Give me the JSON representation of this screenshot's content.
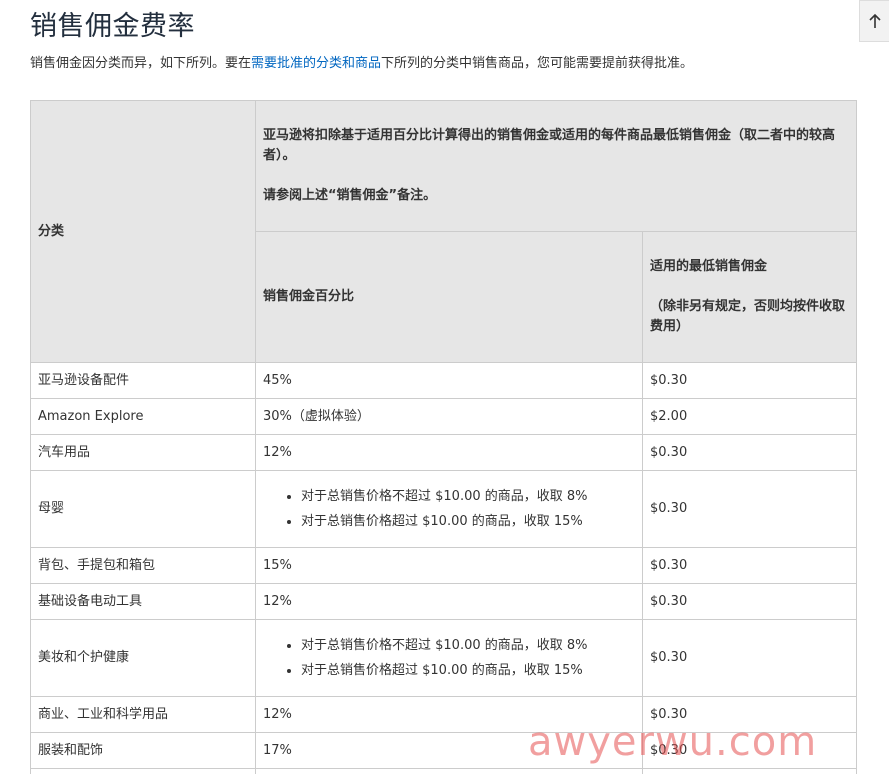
{
  "title": "销售佣金费率",
  "intro": {
    "before": "销售佣金因分类而异，如下所列。要在",
    "link": "需要批准的分类和商品",
    "after": "下所列的分类中销售商品，您可能需要提前获得批准。"
  },
  "table": {
    "header": {
      "category": "分类",
      "main_line1": "亚马逊将扣除基于适用百分比计算得出的销售佣金或适用的每件商品最低销售佣金（取二者中的较高者）。",
      "main_line2": "请参阅上述“销售佣金”备注。",
      "percent": "销售佣金百分比",
      "min_line1": "适用的最低销售佣金",
      "min_line2": "（除非另有规定，否则均按件收取费用）"
    },
    "rows": [
      {
        "category": "亚马逊设备配件",
        "percent": "45%",
        "min": "$0.30"
      },
      {
        "category": "Amazon Explore",
        "percent": "30%（虚拟体验）",
        "min": "$2.00"
      },
      {
        "category": "汽车用品",
        "percent": "12%",
        "min": "$0.30"
      },
      {
        "category": "母婴",
        "percent_items": [
          "对于总销售价格不超过 $10.00 的商品，收取 8%",
          "对于总销售价格超过 $10.00 的商品，收取 15%"
        ],
        "min": "$0.30"
      },
      {
        "category": "背包、手提包和箱包",
        "percent": "15%",
        "min": "$0.30"
      },
      {
        "category": "基础设备电动工具",
        "percent": "12%",
        "min": "$0.30"
      },
      {
        "category": "美妆和个护健康",
        "percent_items": [
          "对于总销售价格不超过 $10.00 的商品，收取 8%",
          "对于总销售价格超过 $10.00 的商品，收取 15%"
        ],
        "min": "$0.30"
      },
      {
        "category": "商业、工业和科学用品",
        "percent": "12%",
        "min": "$0.30"
      },
      {
        "category": "服装和配饰",
        "percent": "17%",
        "min": "$0.30"
      }
    ]
  },
  "scroll_top_icon": "arrow-up-icon",
  "watermark": "awyerwu.com"
}
